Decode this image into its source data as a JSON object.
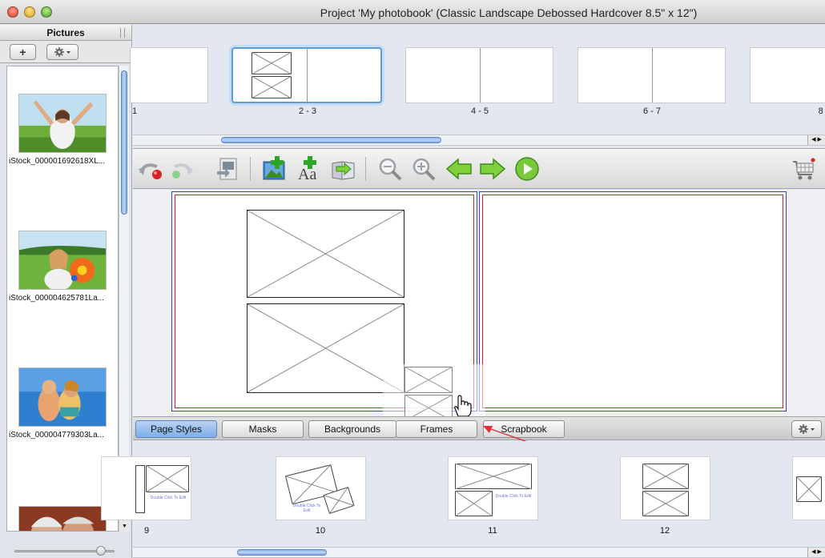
{
  "window": {
    "title": "Project 'My photobook' (Classic Landscape Debossed Hardcover 8.5\" x 12\")"
  },
  "sidebar": {
    "header": "Pictures",
    "add_label": "+",
    "pictures": [
      {
        "name": "iStock_000001692618XL..."
      },
      {
        "name": "iStock_000004625781La..."
      },
      {
        "name": "iStock_000004779303La..."
      }
    ]
  },
  "spreads": [
    {
      "label": "1"
    },
    {
      "label": "2 - 3"
    },
    {
      "label": "4 - 5"
    },
    {
      "label": "6 - 7"
    },
    {
      "label": "8 -"
    }
  ],
  "toolbar": {
    "icons": [
      "undo-icon",
      "redo-icon",
      "export-page-icon",
      "add-picture-icon",
      "add-text-icon",
      "apply-layout-icon",
      "zoom-out-icon",
      "zoom-in-icon",
      "previous-page-icon",
      "next-page-icon",
      "play-slideshow-icon",
      "shopping-cart-icon"
    ]
  },
  "tabs": [
    {
      "label": "Page Styles",
      "active": true
    },
    {
      "label": "Masks"
    },
    {
      "label": "Backgrounds"
    },
    {
      "label": "Frames"
    },
    {
      "label": "Scrapbook"
    }
  ],
  "page_styles": [
    {
      "label": "9",
      "hint": "Double Click To Edit"
    },
    {
      "label": "10",
      "hint": "Double Click To Edit"
    },
    {
      "label": "11",
      "hint": "Double Click To Edit"
    },
    {
      "label": "12"
    }
  ]
}
